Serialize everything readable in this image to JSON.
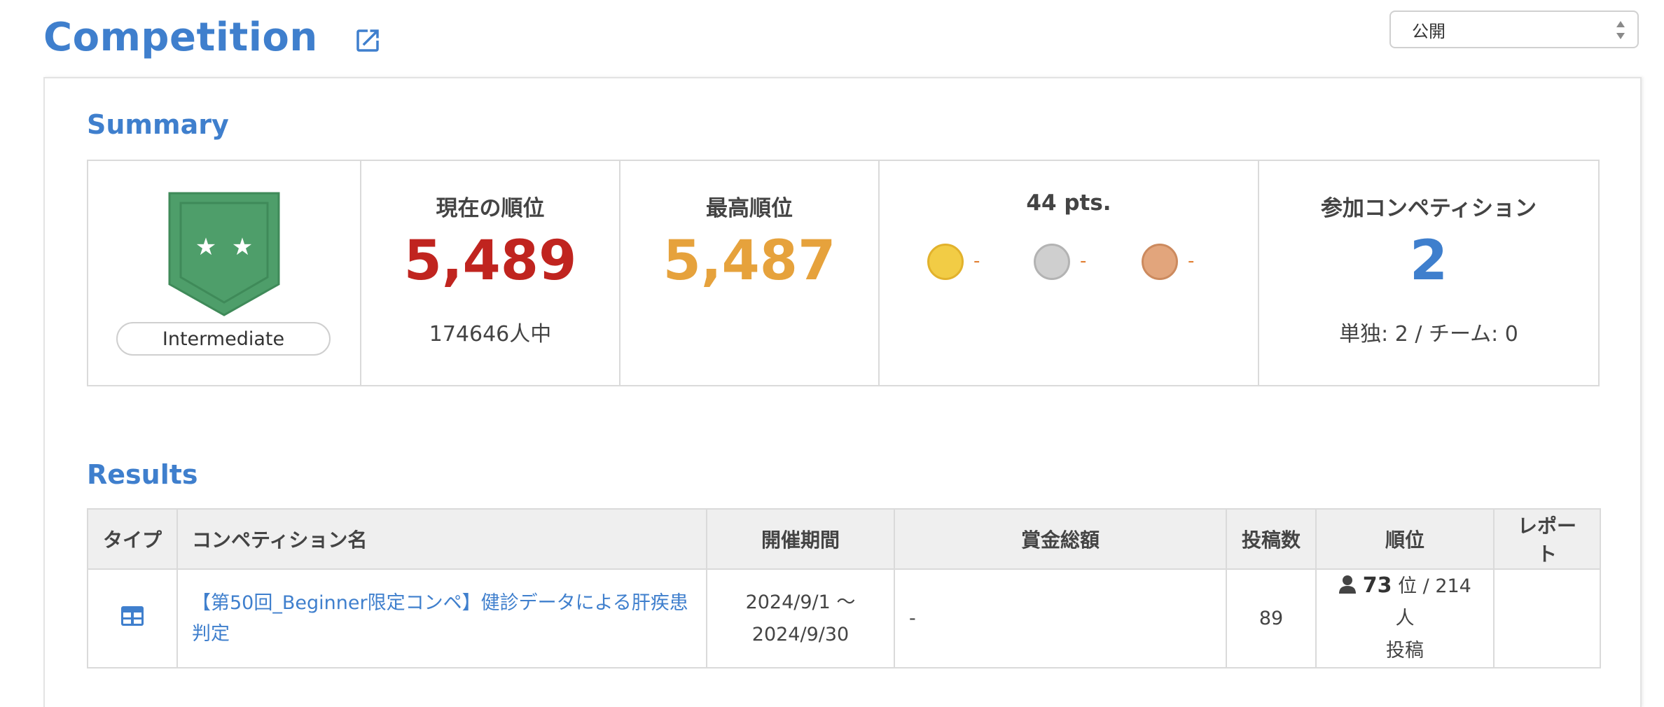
{
  "header": {
    "title": "Competition",
    "visibility": {
      "selected": "公開"
    }
  },
  "colors": {
    "accent": "#3f7fcd",
    "current_rank": "#c0241f",
    "best_rank": "#e6a23c",
    "tier": "#4e9e6a",
    "gold": "#f2cc45",
    "silver": "#cfcfcf",
    "bronze": "#e2a57c"
  },
  "summary": {
    "title": "Summary",
    "tier": {
      "label": "Intermediate",
      "icon": "tier-shield-two-stars-icon"
    },
    "current_rank": {
      "label": "現在の順位",
      "value": "5,489",
      "sub": "174646人中"
    },
    "best_rank": {
      "label": "最高順位",
      "value": "5,487"
    },
    "points": {
      "label": "44 pts.",
      "medals": [
        {
          "type": "gold",
          "count": "-"
        },
        {
          "type": "silver",
          "count": "-"
        },
        {
          "type": "bronze",
          "count": "-"
        }
      ]
    },
    "competitions": {
      "label": "参加コンペティション",
      "value": "2",
      "sub": "単独: 2 / チーム: 0"
    }
  },
  "results": {
    "title": "Results",
    "columns": [
      "タイプ",
      "コンペティション名",
      "開催期間",
      "賞金総額",
      "投稿数",
      "順位",
      "レポート"
    ],
    "rows": [
      {
        "type_icon": "table-grid-icon",
        "name": "【第50回_Beginner限定コンペ】健診データによる肝疾患判定",
        "period_start": "2024/9/1 ～",
        "period_end": "2024/9/30",
        "prize": "-",
        "submissions": "89",
        "rank": "73",
        "rank_unit": "位 / 214人",
        "rank_suffix": "投稿",
        "report": ""
      }
    ]
  }
}
